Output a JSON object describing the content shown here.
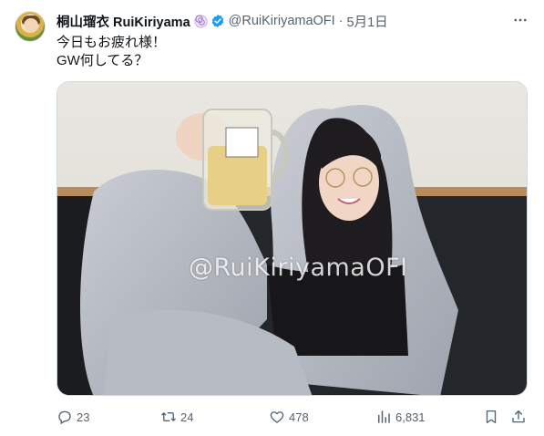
{
  "tweet": {
    "display_name": "桐山瑠衣 RuiKiriyama",
    "handle": "@RuiKiriyamaOFI",
    "separator": "·",
    "date": "5月1日",
    "text_line1": "今日もお疲れ様！",
    "text_line2": "GW何してる？",
    "watermark": "@RuiKiriyamaOFI"
  },
  "actions": {
    "replies": "23",
    "retweets": "24",
    "likes": "478",
    "views": "6,831"
  },
  "colors": {
    "verified": "#1d9bf0",
    "muted_text": "#536471",
    "text": "#0f1419"
  },
  "icons": [
    "avatar",
    "swirl-badge-icon",
    "verified-icon",
    "more-icon",
    "reply-icon",
    "retweet-icon",
    "like-icon",
    "views-icon",
    "bookmark-icon",
    "share-icon"
  ]
}
